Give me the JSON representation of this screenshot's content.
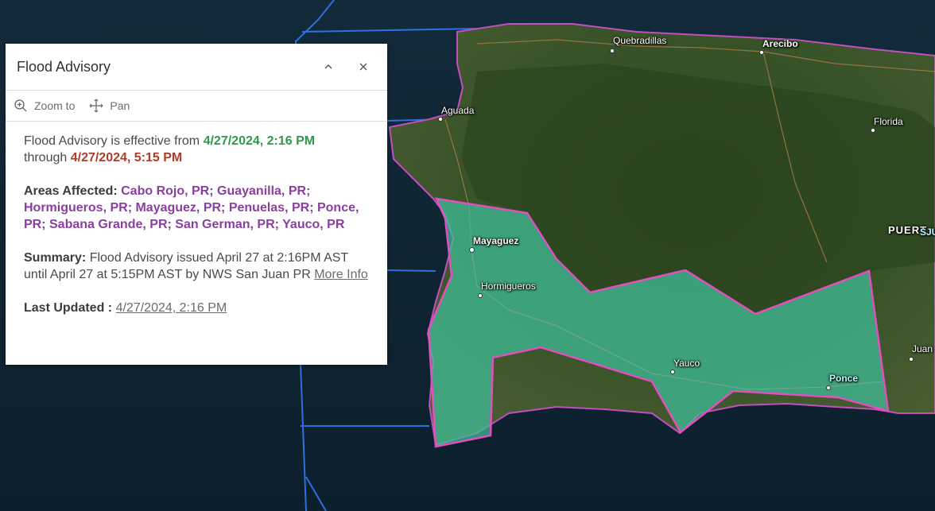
{
  "popup": {
    "title": "Flood Advisory",
    "collapse_icon": "chevron-up-icon",
    "close_icon": "close-icon",
    "actions": {
      "zoom_label": "Zoom to",
      "pan_label": "Pan"
    },
    "effective": {
      "prefix": "Flood Advisory is effective from ",
      "start": "4/27/2024, 2:16 PM",
      "through": "through ",
      "end": "4/27/2024, 5:15 PM"
    },
    "areas": {
      "label": "Areas Affected:",
      "value": "Cabo Rojo, PR; Guayanilla, PR; Hormigueros, PR; Mayaguez, PR; Penuelas, PR; Ponce, PR; Sabana Grande, PR; San German, PR; Yauco, PR"
    },
    "summary": {
      "label": "Summary:",
      "text": "Flood Advisory issued April 27 at 2:16PM AST until April 27 at 5:15PM AST by NWS San Juan PR ",
      "link": "More Info"
    },
    "updated": {
      "label": "Last Updated :",
      "value": "4/27/2024, 2:16 PM"
    },
    "colors": {
      "start_date": "#2f9a4b",
      "end_date": "#b23a2a",
      "areas": "#8a3fa0"
    }
  },
  "map": {
    "places": {
      "quebradillas": "Quebradillas",
      "arecibo": "Arecibo",
      "aguada": "Aguada",
      "florida": "Florida",
      "puerto": "PUERT",
      "sj": "SJU",
      "mayaguez": "Mayaguez",
      "hormigueros": "Hormigueros",
      "yauco": "Yauco",
      "ponce": "Ponce",
      "juana": "Juan"
    },
    "advisory_fill": "#3fbf9a",
    "advisory_outline": "#e24fbf",
    "coast_outline": "#c24fc0"
  }
}
